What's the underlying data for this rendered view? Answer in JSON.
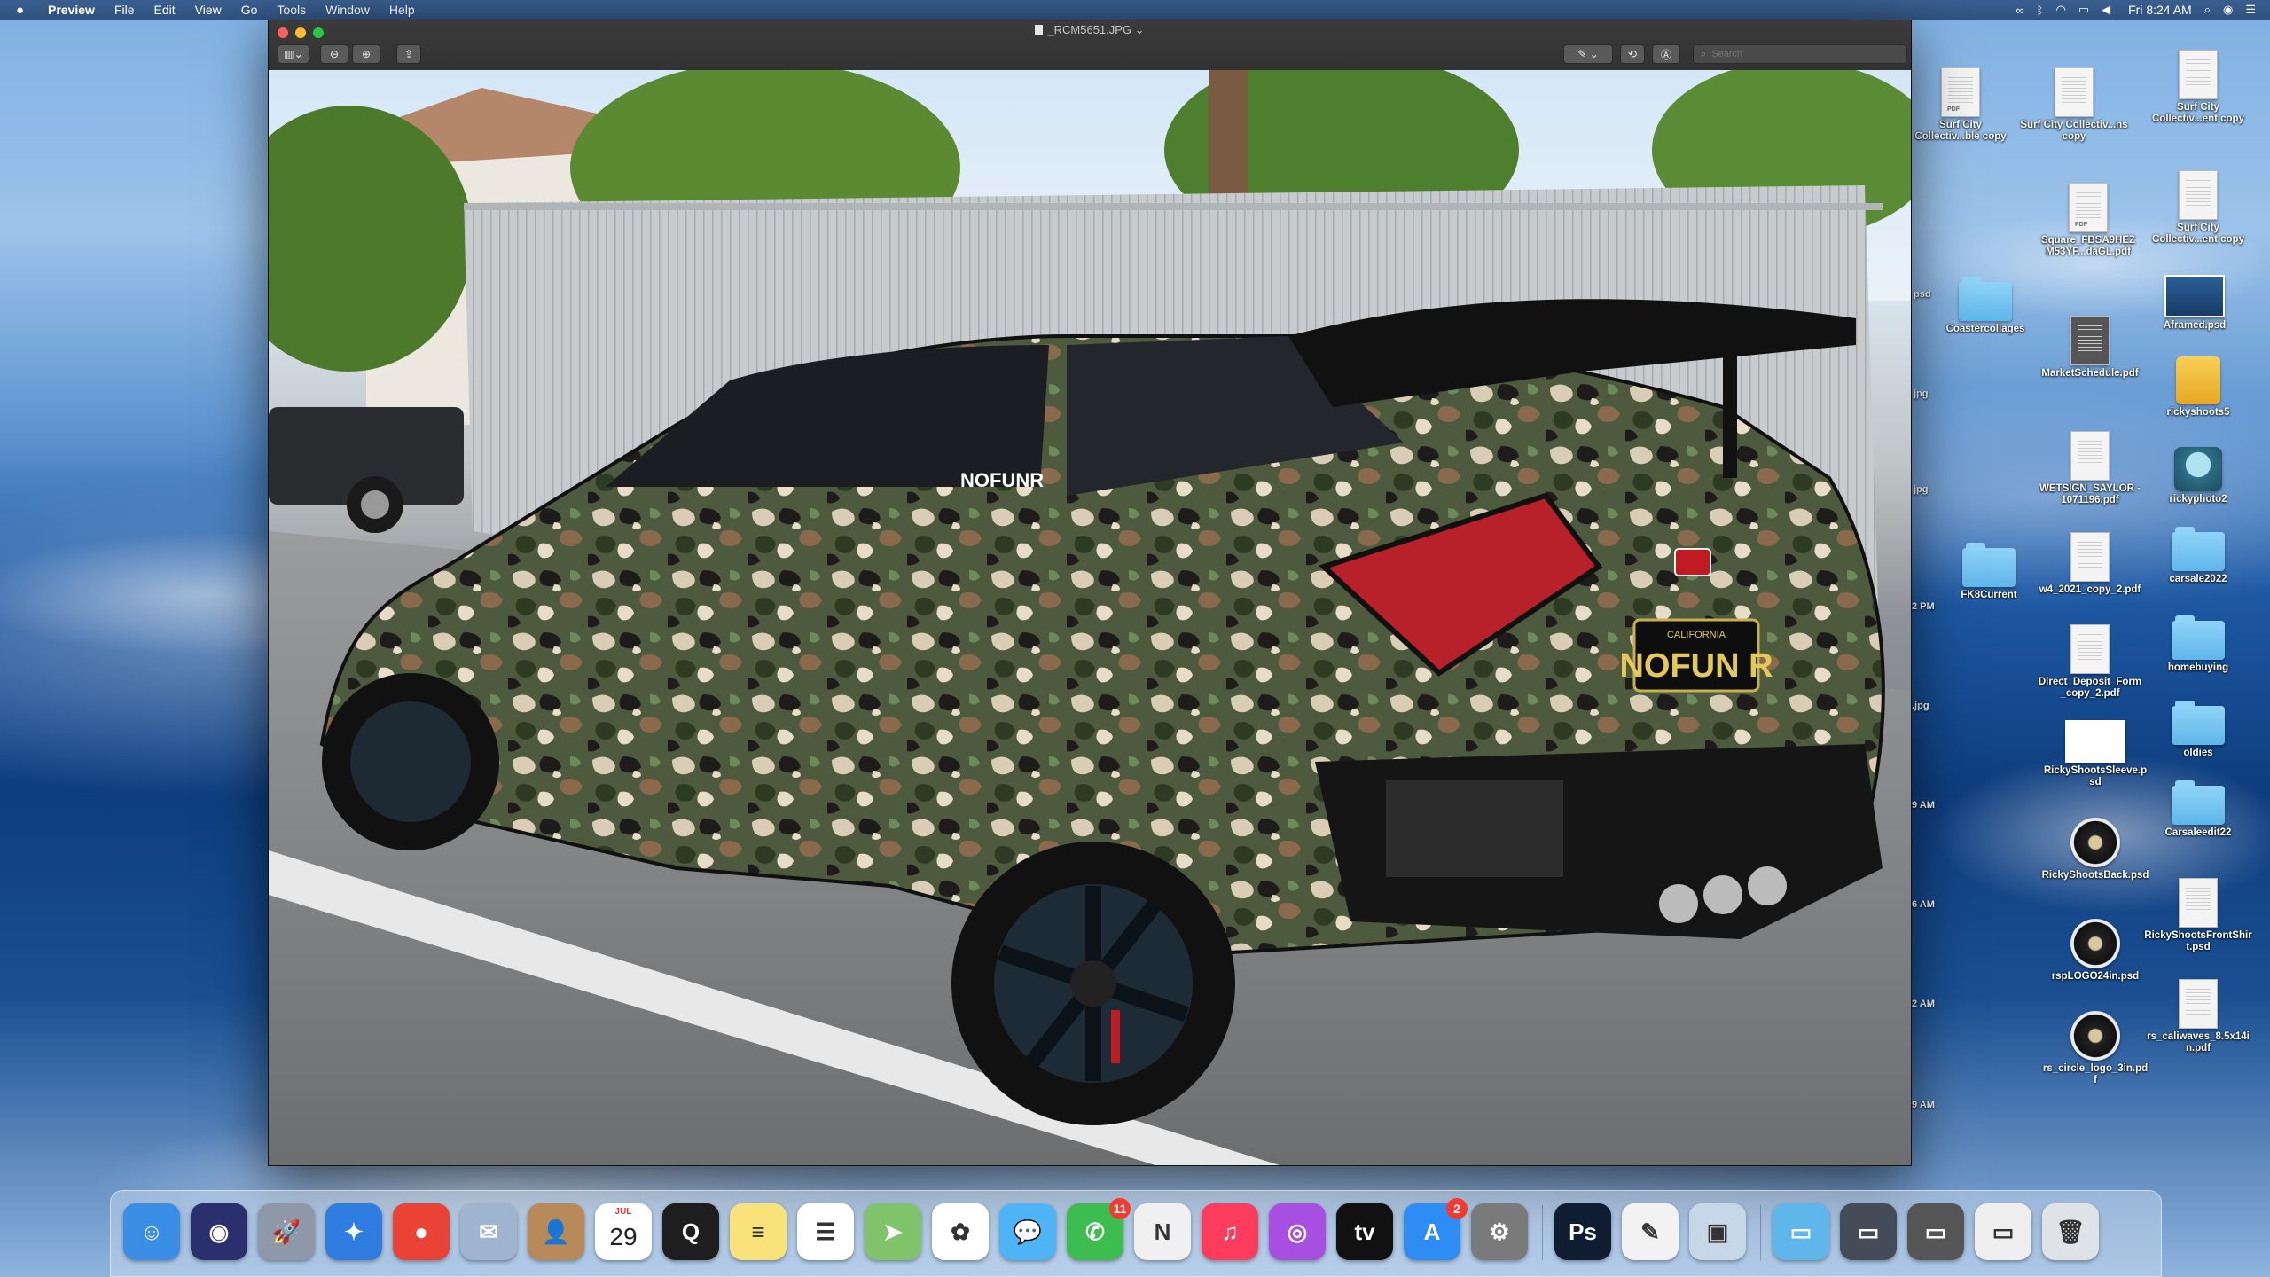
{
  "menubar": {
    "app_name": "Preview",
    "menus": [
      "File",
      "Edit",
      "View",
      "Go",
      "Tools",
      "Window",
      "Help"
    ],
    "clock": "Fri 8:24 AM"
  },
  "window": {
    "title": "_RCM5651.JPG",
    "search_placeholder": "Search"
  },
  "photo": {
    "plate_state": "CALIFORNIA",
    "plate_text": "NOFUN R",
    "window_decal": "NOFUNR"
  },
  "desktop": {
    "icons": [
      {
        "label": "Surf City Collectiv...ble copy",
        "kind": "pdf"
      },
      {
        "label": "Surf City Collectiv...ns copy",
        "kind": "doc"
      },
      {
        "label": "Surf City Collectiv...ent copy",
        "kind": "doc"
      },
      {
        "label": "Square_FBSA9HEZ M53YF...daGL.pdf",
        "kind": "pdf"
      },
      {
        "label": "Surf City Collectiv...ent copy",
        "kind": "doc"
      },
      {
        "label": "Coastercollages",
        "kind": "folder"
      },
      {
        "label": "MarketSchedule.pdf",
        "kind": "doc"
      },
      {
        "label": "Aframed.psd",
        "kind": "thumb"
      },
      {
        "label": "rickyshoots5",
        "kind": "drive"
      },
      {
        "label": "WETSIGN_SAYLOR - 1071196.pdf",
        "kind": "doc"
      },
      {
        "label": "rickyphoto2",
        "kind": "machine"
      },
      {
        "label": "FK8Current",
        "kind": "folder"
      },
      {
        "label": "w4_2021_copy_2.pdf",
        "kind": "doc"
      },
      {
        "label": "carsale2022",
        "kind": "folder"
      },
      {
        "label": "Direct_Deposit_Form_copy_2.pdf",
        "kind": "doc"
      },
      {
        "label": "homebuying",
        "kind": "folder"
      },
      {
        "label": "RickyShootsSleeve.psd",
        "kind": "thumb"
      },
      {
        "label": "oldies",
        "kind": "folder"
      },
      {
        "label": "RickyShootsBack.psd",
        "kind": "circle"
      },
      {
        "label": "Carsaleedit22",
        "kind": "folder"
      },
      {
        "label": "RickyShootsFrontShirt.psd",
        "kind": "doc"
      },
      {
        "label": "rspLOGO24in.psd",
        "kind": "circle"
      },
      {
        "label": "rs_caliwaves_8.5x14in.pdf",
        "kind": "doc"
      },
      {
        "label": "rs_circle_logo_3in.pdf",
        "kind": "circle"
      }
    ],
    "partial_labels": [
      "psd",
      "jpg",
      "jpg",
      "2 PM",
      ".jpg",
      "9 AM",
      "6 AM",
      "2 AM",
      "9 AM"
    ]
  },
  "dock": {
    "apps": [
      {
        "name": "Finder",
        "color": "#3a8ee6",
        "glyph": "☺"
      },
      {
        "name": "Siri",
        "color": "#2a2f6e",
        "glyph": "◉"
      },
      {
        "name": "Launchpad",
        "color": "#8e98a8",
        "glyph": "🚀"
      },
      {
        "name": "Safari",
        "color": "#2f7de1",
        "glyph": "✦"
      },
      {
        "name": "Chrome",
        "color": "#ea4335",
        "glyph": "●"
      },
      {
        "name": "Mail",
        "color": "#9fb5cf",
        "glyph": "✉"
      },
      {
        "name": "Contacts",
        "color": "#b88a5a",
        "glyph": "👤"
      },
      {
        "name": "Calendar",
        "color": "#ffffff",
        "glyph": "29",
        "sub": "JUL"
      },
      {
        "name": "QuickTime",
        "color": "#1e1e1e",
        "glyph": "Q"
      },
      {
        "name": "Notes",
        "color": "#f9e27a",
        "glyph": "≡"
      },
      {
        "name": "Reminders",
        "color": "#ffffff",
        "glyph": "☰"
      },
      {
        "name": "Maps",
        "color": "#7fc46b",
        "glyph": "➤"
      },
      {
        "name": "Photos",
        "color": "#ffffff",
        "glyph": "✿"
      },
      {
        "name": "Messages",
        "color": "#4fb4f5",
        "glyph": "💬"
      },
      {
        "name": "FaceTime",
        "color": "#3dbd4f",
        "glyph": "✆",
        "badge": "11"
      },
      {
        "name": "News",
        "color": "#f0f0f0",
        "glyph": "N"
      },
      {
        "name": "Music",
        "color": "#fc3c5c",
        "glyph": "♫"
      },
      {
        "name": "Podcasts",
        "color": "#a74fe0",
        "glyph": "◎"
      },
      {
        "name": "TV",
        "color": "#111111",
        "glyph": "tv"
      },
      {
        "name": "App Store",
        "color": "#2e8cf5",
        "glyph": "A",
        "badge": "2"
      },
      {
        "name": "System Preferences",
        "color": "#7a7a7a",
        "glyph": "⚙"
      },
      {
        "name": "Photoshop",
        "color": "#0f1d33",
        "glyph": "Ps"
      },
      {
        "name": "TextEdit",
        "color": "#f2f2f2",
        "glyph": "✎"
      },
      {
        "name": "Preview",
        "color": "#c6d7e8",
        "glyph": "▣"
      },
      {
        "name": "Applications",
        "color": "#5fb6ea",
        "glyph": "▭"
      },
      {
        "name": "Downloads",
        "color": "#444c58",
        "glyph": "▭"
      },
      {
        "name": "Recent PSD",
        "color": "#555",
        "glyph": "▭"
      },
      {
        "name": "Screenshot",
        "color": "#eeeeee",
        "glyph": "▭"
      },
      {
        "name": "Trash",
        "color": "#dfe3e8",
        "glyph": "🗑"
      }
    ]
  }
}
